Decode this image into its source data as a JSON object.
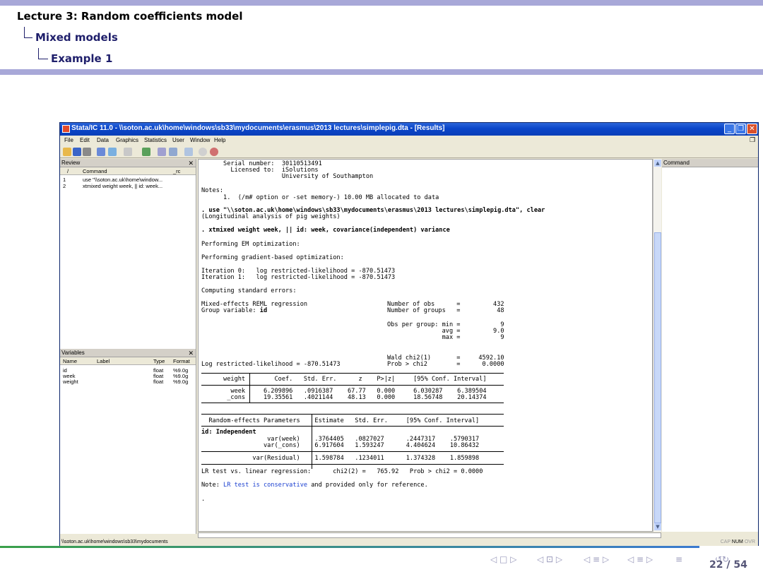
{
  "slide": {
    "title": "Lecture 3: Random coefficients model",
    "section": "Mixed models",
    "subsection": "Example 1",
    "page": "22 / 54",
    "nav_symbols": [
      "◁ □ ▷",
      "◁ ⊡ ▷",
      "◁ ≡ ▷",
      "◁ ≡ ▷",
      "≡",
      "↺↻"
    ]
  },
  "window": {
    "title": "Stata/IC 11.0 - \\\\soton.ac.uk\\home\\windows\\sb33\\mydocuments\\erasmus\\2013 lectures\\simplepig.dta - [Results]",
    "menu": [
      "File",
      "Edit",
      "Data",
      "Graphics",
      "Statistics",
      "User",
      "Window",
      "Help"
    ]
  },
  "review": {
    "title": "Review",
    "columns": [
      "/",
      "Command",
      "_rc"
    ],
    "rows": [
      {
        "n": "1",
        "cmd": "use \"\\\\soton.ac.uk\\home\\window..."
      },
      {
        "n": "2",
        "cmd": "xtmixed weight week, || id: week..."
      }
    ]
  },
  "variables": {
    "title": "Variables",
    "columns": [
      "Name",
      "Label",
      "Type",
      "Format"
    ],
    "rows": [
      {
        "name": "id",
        "type": "float",
        "format": "%9.0g"
      },
      {
        "name": "week",
        "type": "float",
        "format": "%9.0g"
      },
      {
        "name": "weight",
        "type": "float",
        "format": "%9.0g"
      }
    ]
  },
  "command": {
    "title": "Command"
  },
  "results": {
    "serial": "      Serial number:  30110513491",
    "licensed": "        Licensed to:  iSolutions",
    "university": "                      University of Southampton",
    "notes": "Notes:",
    "note1": "      1.  (/m# option or -set memory-) 10.00 MB allocated to data",
    "use_cmd": ". use \"\\\\soton.ac.uk\\home\\windows\\sb33\\mydocuments\\erasmus\\2013 lectures\\simplepig.dta\", clear",
    "dataset_label": "(Longitudinal analysis of pig weights)",
    "xtmixed_cmd": ". xtmixed weight week, || id: week, covariance(independent) variance",
    "em": "Performing EM optimization:",
    "gradient": "Performing gradient-based optimization:",
    "iter0": "Iteration 0:   log restricted-likelihood = -870.51473",
    "iter1": "Iteration 1:   log restricted-likelihood = -870.51473",
    "se": "Computing standard errors:",
    "model_label": "Mixed-effects REML regression",
    "group_label": "Group variable: ",
    "group_var": "id",
    "nobs": "Number of obs      =         432",
    "ngroups": "Number of groups   =          48",
    "obs_min": "Obs per group: min =           9",
    "obs_avg": "               avg =         9.0",
    "obs_max": "               max =           9",
    "wald": "Wald chi2(1)       =     4592.10",
    "prob": "Prob > chi2        =      0.0000",
    "loglik": "Log restricted-likelihood = -870.51473",
    "fixed_header": "      weight        Coef.   Std. Err.      z    P>|z|     [95% Conf. Interval]",
    "fixed_week": "        week     6.209896   .0916387    67.77   0.000     6.030287    6.389504",
    "fixed_cons": "       _cons     19.35561   .4021144    48.13   0.000     18.56748    20.14374",
    "random_header": "  Random-effects Parameters    Estimate   Std. Err.     [95% Conf. Interval]",
    "random_id": "id: Independent",
    "var_week": "                  var(week)    .3764405   .0827027      .2447317    .5790317",
    "var_cons": "                 var(_cons)    6.917604   1.593247      4.404624    10.86432",
    "var_resid": "              var(Residual)    1.598784   .1234011      1.374328    1.859898",
    "lrtest": "LR test vs. linear regression:      chi2(2) =   765.92   Prob > chi2 = 0.0000",
    "note_prefix": "Note: ",
    "note_link": "LR test is conservative",
    "note_suffix": " and provided only for reference.",
    "prompt": "."
  },
  "status": {
    "path": "\\\\soton.ac.uk\\home\\windows\\sb33\\mydocuments",
    "cap": "CAP",
    "num": "NUM",
    "ovr": "OVR"
  }
}
